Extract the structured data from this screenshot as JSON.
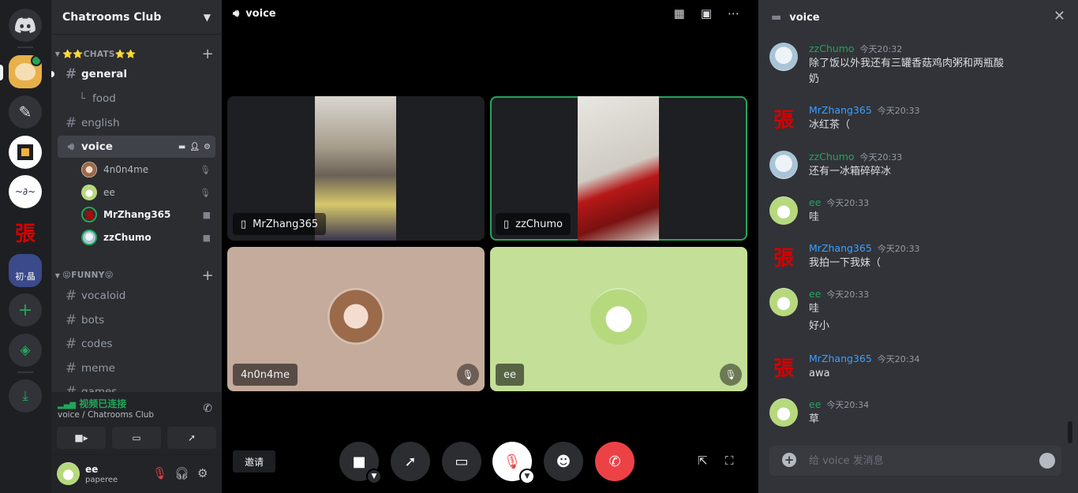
{
  "server": {
    "name": "Chatrooms Club"
  },
  "categories": [
    {
      "label": "⭐⭐CHATS⭐⭐"
    },
    {
      "label": "😝FUNNY😝"
    }
  ],
  "channels": {
    "general": "general",
    "food": "food",
    "english": "english",
    "voice": "voice",
    "vocaloid": "vocaloid",
    "bots": "bots",
    "codes": "codes",
    "meme": "meme",
    "games": "games"
  },
  "voice_users": [
    {
      "name": "4n0n4me"
    },
    {
      "name": "ee"
    },
    {
      "name": "MrZhang365"
    },
    {
      "name": "zzChumo"
    }
  ],
  "rail": {
    "zhang_glyph": "張",
    "team_label": "初·晶"
  },
  "voice_panel": {
    "status": "视频已连接",
    "location": "voice / Chatrooms Club"
  },
  "user": {
    "name": "ee",
    "tag": "paperee"
  },
  "stage": {
    "title": "voice",
    "tiles": [
      {
        "name": "MrZhang365"
      },
      {
        "name": "zzChumo"
      },
      {
        "name": "4n0n4me"
      },
      {
        "name": "ee"
      }
    ],
    "invite_label": "邀请"
  },
  "chat": {
    "title": "voice",
    "placeholder": "给 voice 发消息",
    "messages": [
      {
        "author": "zzChumo",
        "time": "今天20:32",
        "lines": [
          "除了饭以外我还有三罐香菇鸡肉粥和两瓶酸",
          "奶"
        ]
      },
      {
        "author": "MrZhang365",
        "time": "今天20:33",
        "lines": [
          "冰红茶（"
        ]
      },
      {
        "author": "zzChumo",
        "time": "今天20:33",
        "lines": [
          "还有一冰箱碎碎冰"
        ]
      },
      {
        "author": "ee",
        "time": "今天20:33",
        "lines": [
          "哇"
        ]
      },
      {
        "author": "MrZhang365",
        "time": "今天20:33",
        "lines": [
          "我拍一下我妹（"
        ]
      },
      {
        "author": "ee",
        "time": "今天20:33",
        "lines": [
          "哇",
          "好小"
        ]
      },
      {
        "author": "MrZhang365",
        "time": "今天20:34",
        "lines": [
          "awa"
        ]
      },
      {
        "author": "ee",
        "time": "今天20:34",
        "lines": [
          "草"
        ]
      }
    ]
  },
  "colors": {
    "connected": "#23a55a",
    "hangup": "#ed4245",
    "author_green": "#23a55a",
    "author_blue": "#3ba0ff",
    "speaking_outline": "#23a55a"
  }
}
